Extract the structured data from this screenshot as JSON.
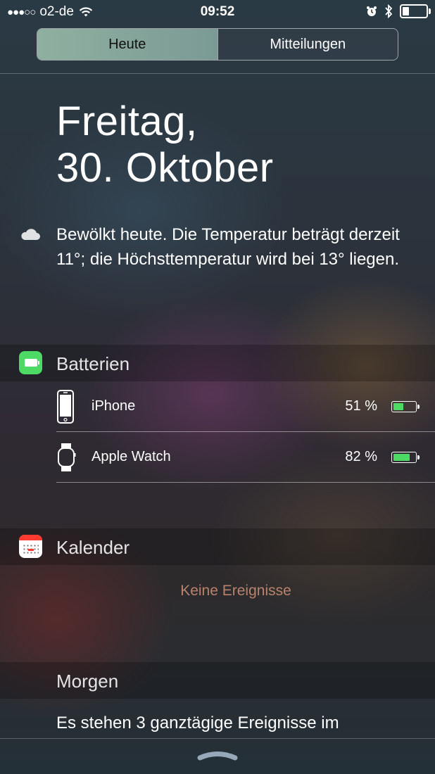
{
  "status_bar": {
    "signal_dots": "●●●○○",
    "carrier": "o2-de",
    "time": "09:52",
    "icons": [
      "wifi-icon",
      "alarm-icon",
      "bluetooth-icon",
      "battery-icon"
    ]
  },
  "tabs": [
    {
      "label": "Heute",
      "active": true
    },
    {
      "label": "Mitteilungen",
      "active": false
    }
  ],
  "date": {
    "weekday": "Freitag,",
    "day_month": "30. Oktober"
  },
  "weather": {
    "icon": "cloud-icon",
    "text": "Bewölkt heute. Die Temperatur beträgt derzeit 11°; die Höchsttemperatur wird bei 13° liegen."
  },
  "batteries": {
    "title": "Batterien",
    "devices": [
      {
        "name": "iPhone",
        "percent_text": "51 %",
        "level": 0.51,
        "icon": "iphone-icon"
      },
      {
        "name": "Apple Watch",
        "percent_text": "82 %",
        "level": 0.82,
        "icon": "apple-watch-icon"
      }
    ]
  },
  "calendar": {
    "title": "Kalender",
    "empty_text": "Keine Ereignisse"
  },
  "tomorrow": {
    "title": "Morgen",
    "text": "Es stehen 3 ganztägige Ereignisse im"
  },
  "colors": {
    "accent_green": "#4cd964",
    "calendar_red": "#ff3b30",
    "active_tab": "#8fb0a0"
  }
}
